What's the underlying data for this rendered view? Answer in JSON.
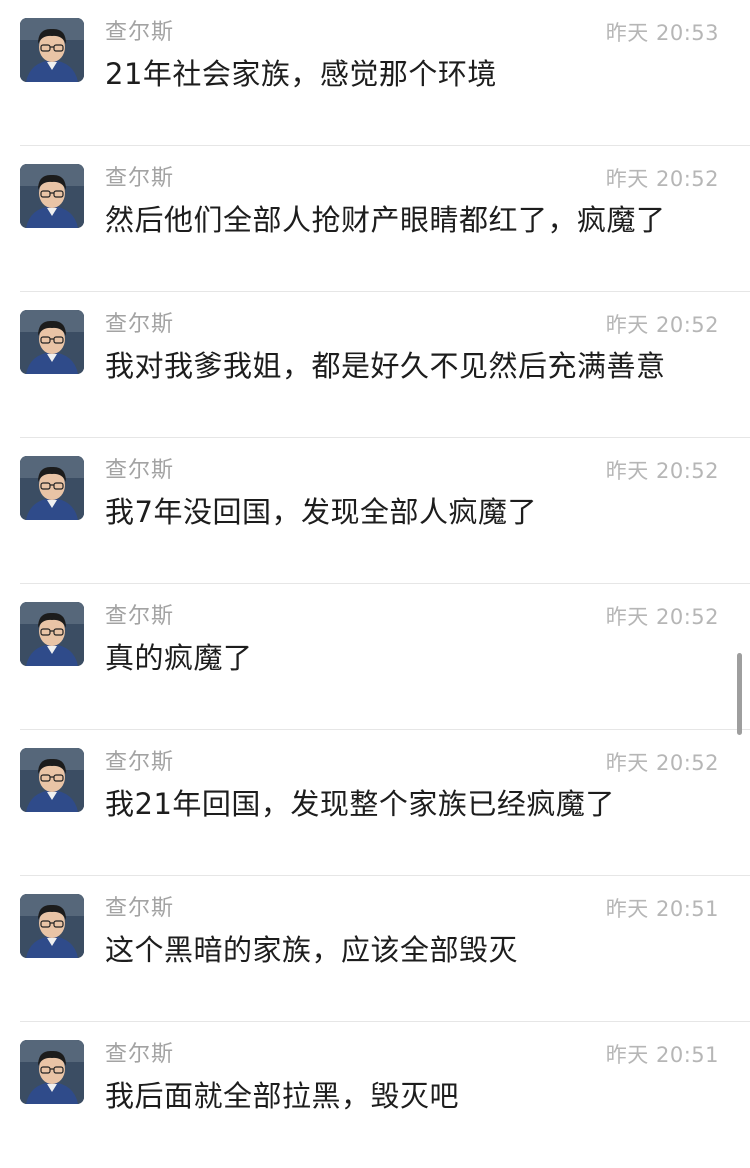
{
  "messages": [
    {
      "sender": "查尔斯",
      "time": "昨天 20:53",
      "text": "21年社会家族，感觉那个环境"
    },
    {
      "sender": "查尔斯",
      "time": "昨天 20:52",
      "text": "然后他们全部人抢财产眼睛都红了，疯魔了"
    },
    {
      "sender": "查尔斯",
      "time": "昨天 20:52",
      "text": "我对我爹我姐，都是好久不见然后充满善意"
    },
    {
      "sender": "查尔斯",
      "time": "昨天 20:52",
      "text": "我7年没回国，发现全部人疯魔了"
    },
    {
      "sender": "查尔斯",
      "time": "昨天 20:52",
      "text": "真的疯魔了"
    },
    {
      "sender": "查尔斯",
      "time": "昨天 20:52",
      "text": "我21年回国，发现整个家族已经疯魔了"
    },
    {
      "sender": "查尔斯",
      "time": "昨天 20:51",
      "text": "这个黑暗的家族，应该全部毁灭"
    },
    {
      "sender": "查尔斯",
      "time": "昨天 20:51",
      "text": "我后面就全部拉黑，毁灭吧"
    }
  ],
  "colors": {
    "sender": "#a3a3a3",
    "time": "#b6b6b6",
    "text": "#1d1d1d",
    "divider": "#e6e6e6",
    "scrollbar": "#9e9e9e"
  }
}
